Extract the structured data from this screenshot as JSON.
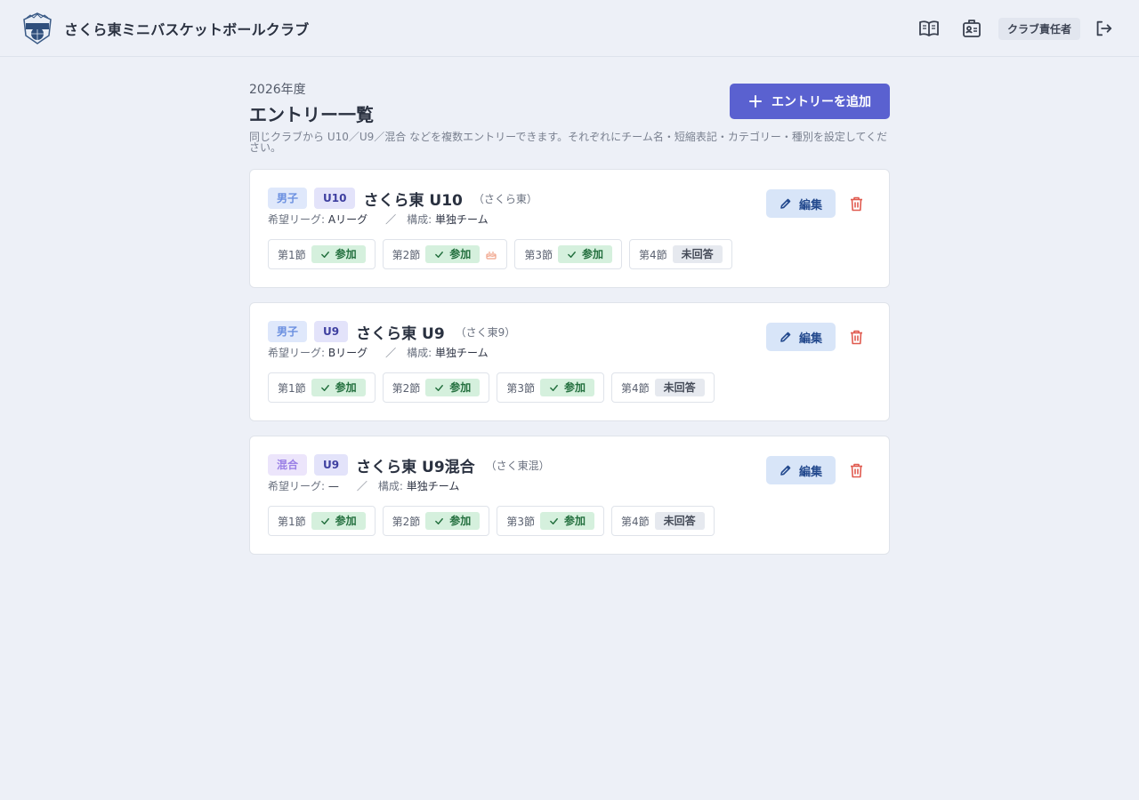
{
  "header": {
    "app_title": "さくら東ミニバスケットボールクラブ",
    "logo_text": "HYOGO",
    "role_badge": "クラブ責任者",
    "icons": [
      "book-open-icon",
      "id-card-icon",
      "logout-icon"
    ]
  },
  "page": {
    "year": "2026年度",
    "title": "エントリー一覧",
    "subtitle": "同じクラブから U10／U9／混合 などを複数エントリーできます。それぞれにチーム名・短縮表記・カテゴリー・種別を設定してください。",
    "add_button_label": "エントリーを追加"
  },
  "labels": {
    "league_prefix": "希望リーグ: ",
    "composition_prefix": "構成: ",
    "separator": "／",
    "edit": "編集"
  },
  "entries": [
    {
      "gender": "男子",
      "age": "U10",
      "name": "さくら東 U10",
      "short": "（さくら東）",
      "league": "Aリーグ",
      "composition": "単独チーム",
      "rounds": [
        {
          "label": "第1節",
          "status": "参加"
        },
        {
          "label": "第2節",
          "status": "参加"
        },
        {
          "label": "第3節",
          "status": "参加"
        },
        {
          "label": "第4節",
          "status": "未回答"
        }
      ]
    },
    {
      "gender": "男子",
      "age": "U9",
      "name": "さくら東 U9",
      "short": "（さく東9）",
      "league": "Bリーグ",
      "composition": "単独チーム",
      "rounds": [
        {
          "label": "第1節",
          "status": "参加"
        },
        {
          "label": "第2節",
          "status": "参加"
        },
        {
          "label": "第3節",
          "status": "参加"
        },
        {
          "label": "第4節",
          "status": "未回答"
        }
      ]
    },
    {
      "gender": "混合",
      "age": "U9",
      "name": "さくら東 U9混合",
      "short": "（さく東混）",
      "league": "—",
      "composition": "単独チーム",
      "rounds": [
        {
          "label": "第1節",
          "status": "参加"
        },
        {
          "label": "第2節",
          "status": "参加"
        },
        {
          "label": "第3節",
          "status": "参加"
        },
        {
          "label": "第4節",
          "status": "未回答"
        }
      ]
    }
  ],
  "colors": {
    "primary": "#5a61d0",
    "background": "#edf0f7",
    "ok_bg": "#d5f0dd",
    "ok_text": "#24703f",
    "delete": "#e05a4f"
  }
}
